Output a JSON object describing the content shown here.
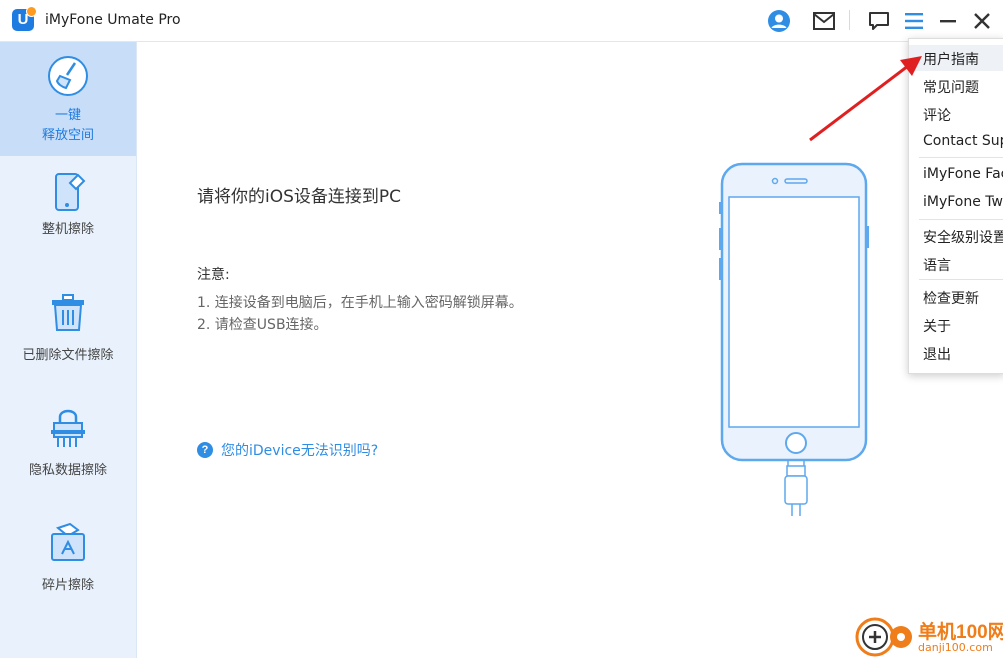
{
  "app": {
    "title": "iMyFone Umate Pro",
    "logo_letter": "U"
  },
  "titlebar": {
    "icons": [
      "account-icon",
      "mail-icon",
      "feedback-icon",
      "menu-icon",
      "minimize-icon",
      "close-icon"
    ]
  },
  "sidebar": {
    "items": [
      {
        "label_line1": "一键",
        "label_line2": "释放空间",
        "icon": "broom-icon",
        "active": true
      },
      {
        "label": "整机擦除",
        "icon": "phone-erase-icon"
      },
      {
        "label": "已删除文件擦除",
        "icon": "trash-icon"
      },
      {
        "label": "隐私数据擦除",
        "icon": "lock-shred-icon"
      },
      {
        "label": "碎片擦除",
        "icon": "fragment-icon"
      }
    ]
  },
  "main": {
    "title": "请将你的iOS设备连接到PC",
    "note_title": "注意:",
    "notes": [
      "1. 连接设备到电脑后，在手机上输入密码解锁屏幕。",
      "2. 请检查USB连接。"
    ],
    "help_link": "您的iDevice无法识别吗?"
  },
  "menu": {
    "items": [
      "用户指南",
      "常见问题",
      "评论",
      "Contact Support",
      "iMyFone Facebook",
      "iMyFone Twitter",
      "安全级别设置",
      "语言",
      "检查更新",
      "关于",
      "退出"
    ],
    "hovered_index": 0
  },
  "watermark": {
    "line1": "单机100网",
    "line2": "danji100.com"
  },
  "colors": {
    "accent": "#1e7be0",
    "sidebar_bg": "#e9f2fc",
    "sidebar_active": "#c8def8",
    "arrow": "#e02020"
  }
}
